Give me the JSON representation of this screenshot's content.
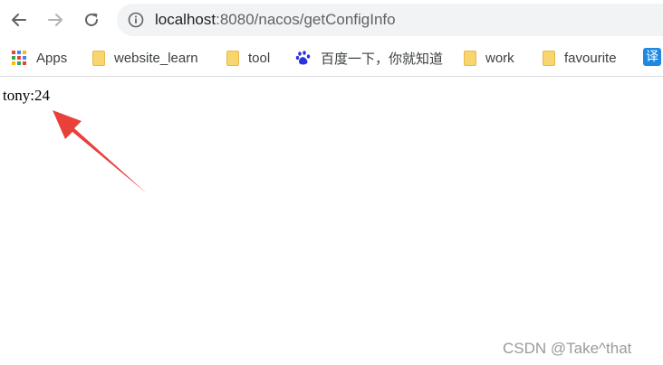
{
  "browser": {
    "url": {
      "host": "localhost",
      "path": ":8080/nacos/getConfigInfo"
    },
    "nav": {
      "back_icon": "arrow-left-icon",
      "forward_icon": "arrow-right-icon",
      "reload_icon": "reload-icon",
      "info_icon": "info-circle-icon"
    }
  },
  "bookmarks": {
    "items": [
      {
        "label": "Apps",
        "icon": "apps-grid-icon"
      },
      {
        "label": "website_learn",
        "icon": "folder-icon"
      },
      {
        "label": "tool",
        "icon": "folder-icon"
      },
      {
        "label": "百度一下，你就知道",
        "icon": "baidu-paw-icon"
      },
      {
        "label": "work",
        "icon": "folder-icon"
      },
      {
        "label": "favourite",
        "icon": "folder-icon"
      }
    ],
    "translate_label": "译"
  },
  "page": {
    "body_text": "tony:24"
  },
  "annotation": {
    "arrow_color": "#e8413a"
  },
  "watermark": "CSDN @Take^that"
}
